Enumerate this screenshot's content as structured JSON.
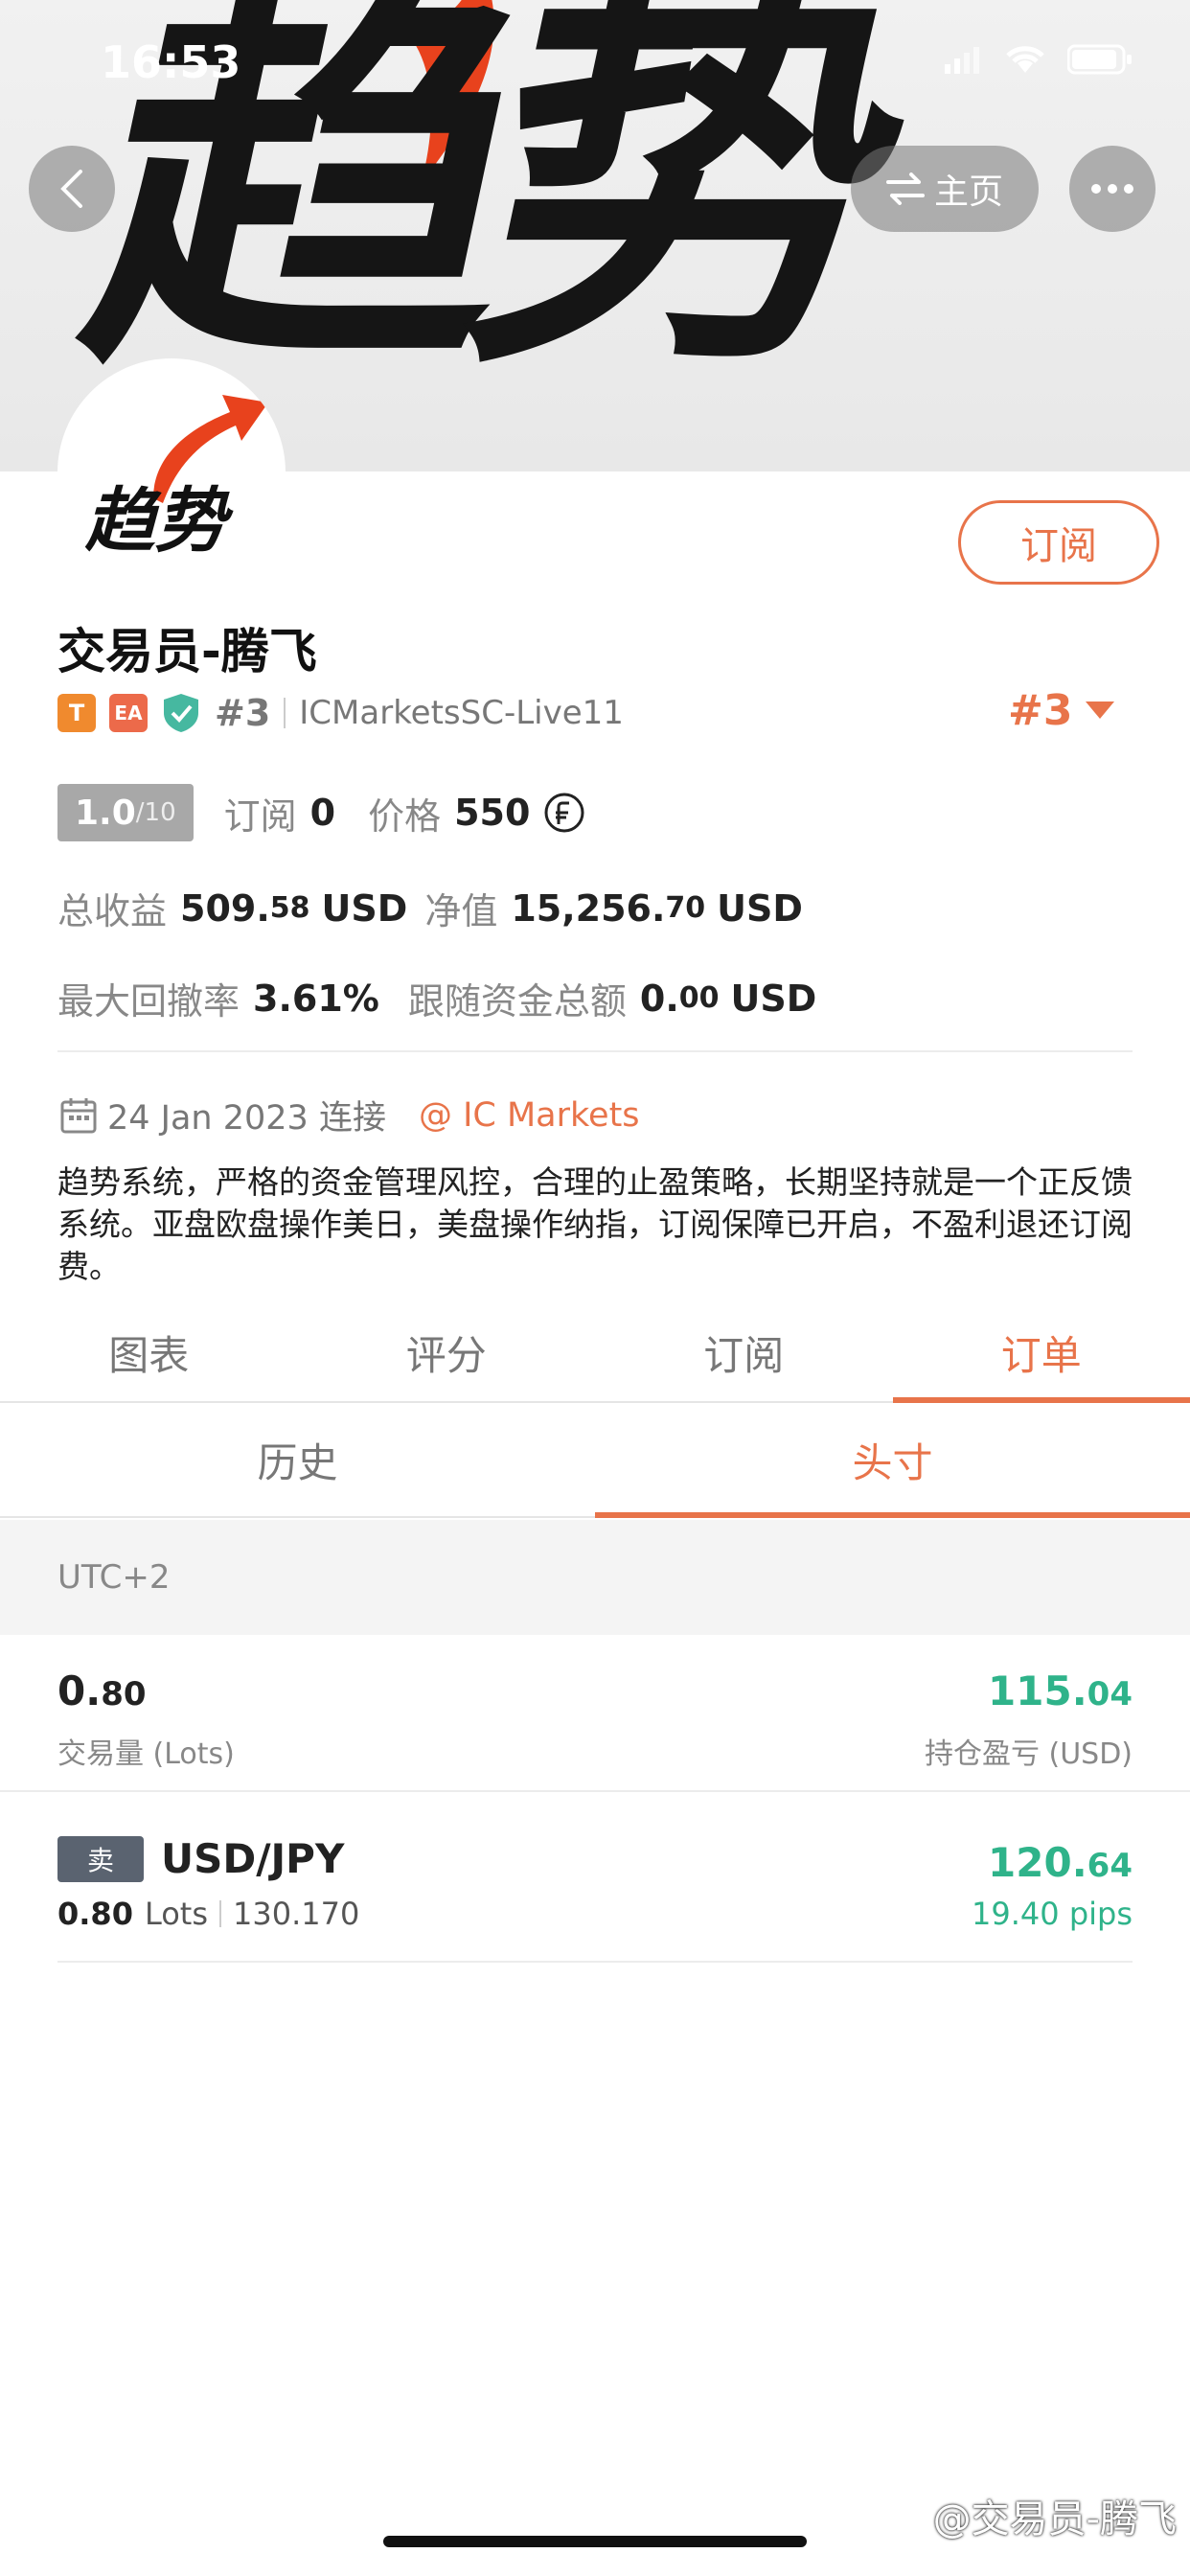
{
  "status_bar": {
    "time": "16:53"
  },
  "header": {
    "home_label": "主页"
  },
  "banner": {
    "title_art": "趋势"
  },
  "profile": {
    "avatar_text": "趋势",
    "subscribe_button": "订阅",
    "name": "交易员-腾飞",
    "tag_t": "T",
    "tag_ea": "EA",
    "rank_small": "#3",
    "server": "ICMarketsSC-Live11",
    "rank_big": "#3"
  },
  "stats": {
    "score_main": "1.0",
    "score_sub": "/10",
    "subscribe_label": "订阅",
    "subscribe_count": "0",
    "price_label": "价格",
    "price_value": "550",
    "price_icon": "currency-coin-icon",
    "total_profit_label": "总收益",
    "total_profit_int": "509.",
    "total_profit_dec": "58",
    "total_profit_unit": "USD",
    "equity_label": "净值",
    "equity_int": "15,256.",
    "equity_dec": "70",
    "equity_unit": "USD",
    "max_drawdown_label": "最大回撤率",
    "max_drawdown_value": "3.61%",
    "follow_funds_label": "跟随资金总额",
    "follow_funds_int": "0.",
    "follow_funds_dec": "00",
    "follow_funds_unit": "USD"
  },
  "info": {
    "date": "24 Jan 2023 连接",
    "broker": "IC Markets",
    "description": "趋势系统，严格的资金管理风控，合理的止盈策略，长期坚持就是一个正反馈系统。亚盘欧盘操作美日，美盘操作纳指，订阅保障已开启，不盈利退还订阅费。"
  },
  "tabs": [
    {
      "label": "图表"
    },
    {
      "label": "评分"
    },
    {
      "label": "订阅"
    },
    {
      "label": "订单"
    }
  ],
  "subtabs": [
    {
      "label": "历史"
    },
    {
      "label": "头寸"
    }
  ],
  "timezone": "UTC+2",
  "summary": {
    "lots_int": "0.",
    "lots_dec": "80",
    "lots_caption": "交易量 (Lots)",
    "pnl_int": "115.",
    "pnl_dec": "04",
    "pnl_caption": "持仓盈亏 (USD)"
  },
  "orders": [
    {
      "side": "卖",
      "symbol": "USD/JPY",
      "lots": "0.80",
      "lots_unit": "Lots",
      "price": "130.170",
      "profit_int": "120.",
      "profit_dec": "64",
      "pips": "19.40 pips"
    }
  ],
  "watermark": "@交易员-腾飞",
  "colors": {
    "accent": "#e8744a",
    "profit": "#2fb38a"
  }
}
